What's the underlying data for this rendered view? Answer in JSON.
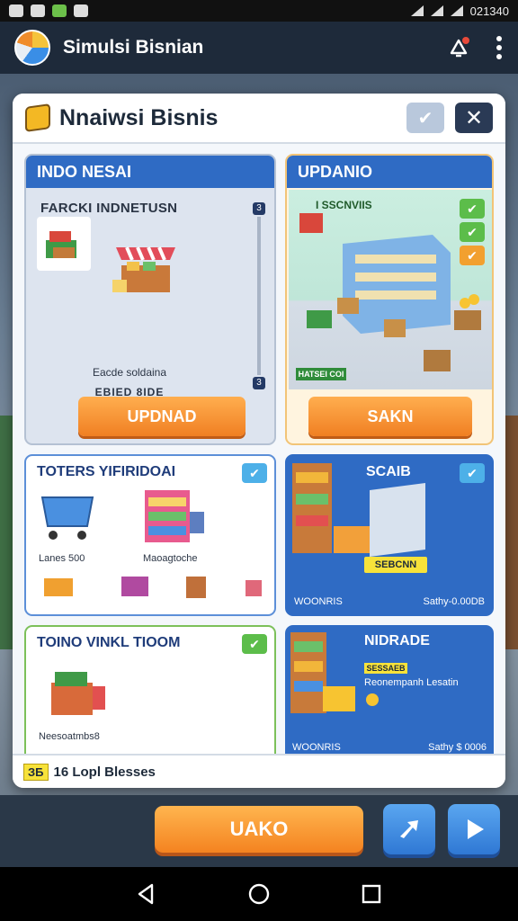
{
  "status_bar": {
    "time": "021340"
  },
  "app_bar": {
    "title": "Simulsi Bisnian"
  },
  "dialog": {
    "title": "Nnaiwsi Bisnis",
    "cards": {
      "card1": {
        "header": "INDO NESAI",
        "subtitle": "FARCKI   INDNETUSN",
        "scroll_top": "3",
        "scroll_bottom": "3",
        "text1": "Eacde soldaina",
        "text2": "EBIED 8IDE",
        "button": "UPDNAD"
      },
      "card2": {
        "header": "UPDANIO",
        "subtitle": "I SSCNVIIS",
        "tag": "HATSEI COI",
        "button": "SAKN"
      },
      "card3": {
        "header": "TOTERS YIFIRIDOAI",
        "label1": "Lanes 500",
        "label2": "Maoagtoche"
      },
      "card4": {
        "header": "SCAIB",
        "tag": "SEBCNN",
        "footer_left": "WOONRIS",
        "footer_right": "Sathy-0.00DB"
      },
      "card5": {
        "header": "TOINO VINKL TIOOM",
        "label": "Neesoatmbs8"
      },
      "card6": {
        "header": "NIDRADE",
        "tag": "SESSAEB",
        "desc": "Reonempanh Lesatin",
        "footer_left": "WOONRIS",
        "footer_right": "Sathy $ 0006"
      }
    },
    "footer": {
      "badge": "ЗБ",
      "text": "16 Lopl Blesses"
    }
  },
  "bottom": {
    "main_button": "UAKO"
  },
  "colors": {
    "accent_blue": "#2f6bc4",
    "accent_orange": "#f07f22",
    "check_green": "#5cbd4a",
    "check_blue": "#4db0e8",
    "highlight_yellow": "#f7e23a"
  },
  "icons": {
    "app_logo": "cube-logo-icon",
    "alert": "bell-alert-icon",
    "menu": "more-vert-icon",
    "check": "check-icon",
    "close": "close-icon",
    "share": "share-arrow-icon",
    "play": "play-icon",
    "nav_back": "back-icon",
    "nav_home": "home-icon",
    "nav_recent": "recent-apps-icon"
  }
}
